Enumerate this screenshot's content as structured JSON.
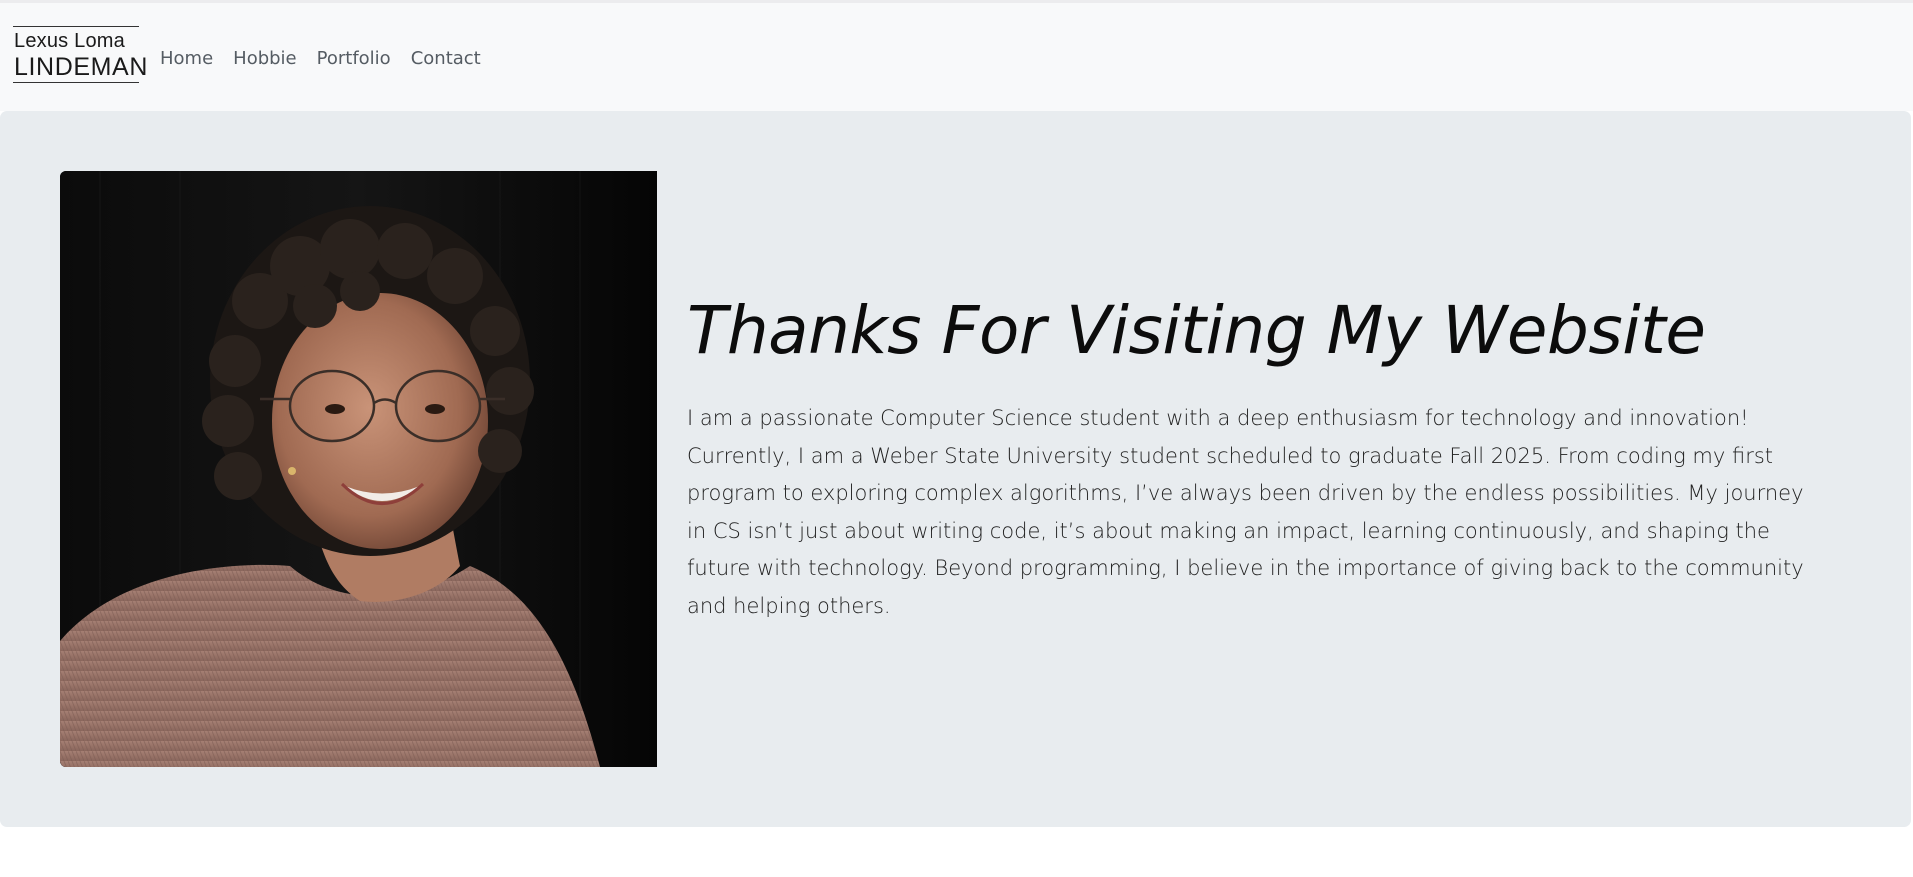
{
  "navbar": {
    "brand_line1": "Lexus Loma",
    "brand_line2": "LINDEMAN",
    "links": [
      {
        "label": "Home"
      },
      {
        "label": "Hobbie"
      },
      {
        "label": "Portfolio"
      },
      {
        "label": "Contact"
      }
    ]
  },
  "hero": {
    "title": "Thanks For Visiting My Website",
    "body": "I am a passionate Computer Science student with a deep enthusiasm for technology and innovation! Currently, I am a Weber State University student scheduled to graduate Fall 2025. From coding my first program to exploring complex algorithms, I’ve always been driven by the endless possibilities. My journey in CS isn’t just about writing code, it’s about making an impact, learning continuously, and shaping the future with technology. Beyond programming, I believe in the importance of giving back to the community and helping others.",
    "photo_alt": "portrait photo"
  },
  "colors": {
    "navbar_bg": "#f8f9fa",
    "hero_bg": "#e8ecef",
    "nav_link": "#555c63"
  }
}
